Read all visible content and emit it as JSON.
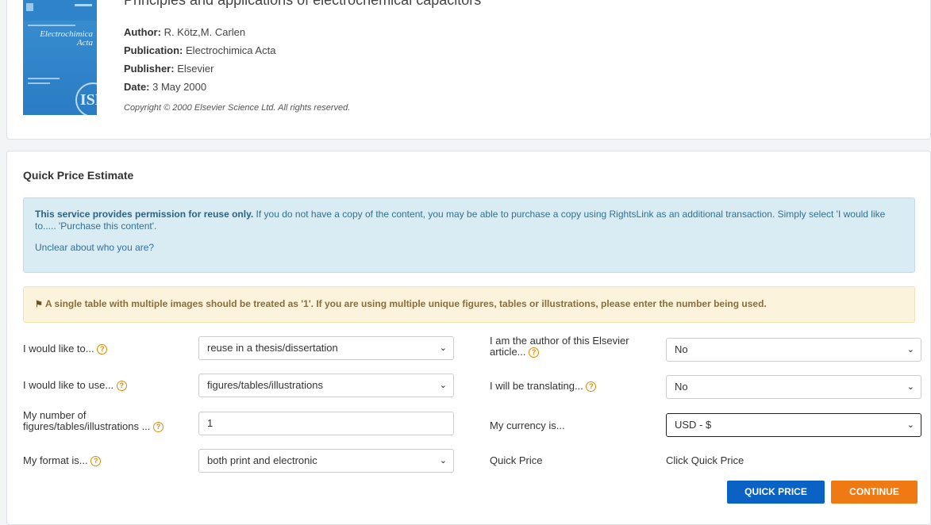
{
  "article": {
    "title": "Principles and applications of electrochemical capacitors",
    "author_label": "Author:",
    "author": "R. Kötz,M. Carlen",
    "publication_label": "Publication:",
    "publication": "Electrochimica Acta",
    "publisher_label": "Publisher:",
    "publisher": "Elsevier",
    "date_label": "Date:",
    "date": "3 May 2000",
    "copyright": "Copyright © 2000 Elsevier Science Ltd. All rights reserved.",
    "cover": {
      "journal_line1": "Electrochimica",
      "journal_line2": "Acta",
      "seal": "ISE"
    }
  },
  "estimate": {
    "title": "Quick Price Estimate",
    "info": {
      "strong": "This service provides permission for reuse only.",
      "text": " If you do not have a copy of the content, you may be able to purchase a copy using RightsLink as an additional transaction. Simply select 'I would like to..... 'Purchase this content'.",
      "unclear_prefix": "Unclear about ",
      "unclear_link": "who you are?"
    },
    "warning": "A single table with multiple images should be treated as '1'. If you are using multiple unique figures, tables or illustrations, please enter the number being used.",
    "left_fields": [
      {
        "label": "I would like to...",
        "value": "reuse in a thesis/dissertation"
      },
      {
        "label": "I would like to use...",
        "value": "figures/tables/illustrations"
      },
      {
        "label_line1": "My number of",
        "label_line2": "figures/tables/illustrations ...",
        "value": "1"
      },
      {
        "label": "My format is...",
        "value": "both print and electronic"
      }
    ],
    "right_fields": [
      {
        "label_line1": "I am the author of this Elsevier",
        "label_line2": "article...",
        "value": "No"
      },
      {
        "label": "I will be translating...",
        "value": "No"
      },
      {
        "label": "My currency is...",
        "value": "USD - $"
      },
      {
        "label": "Quick Price",
        "value": "Click Quick Price"
      }
    ],
    "help_icon": "?",
    "chevron": "⌄",
    "buttons": {
      "quick_price": "QUICK PRICE",
      "continue": "CONTINUE"
    }
  }
}
